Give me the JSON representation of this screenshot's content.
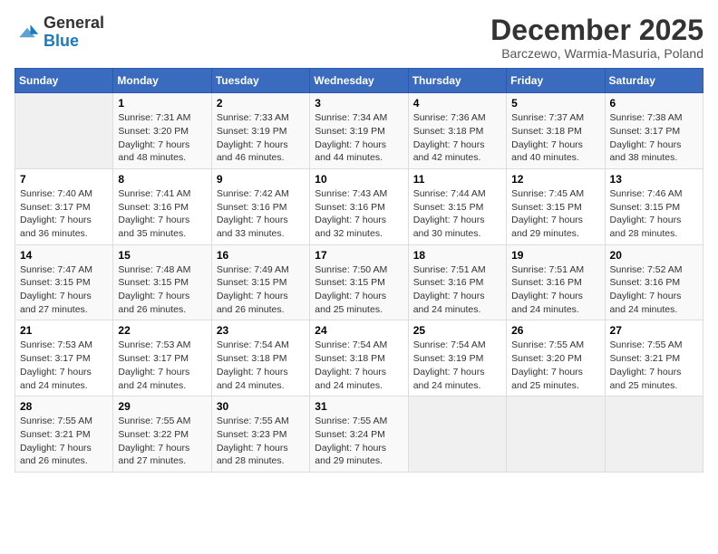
{
  "header": {
    "logo_general": "General",
    "logo_blue": "Blue",
    "title": "December 2025",
    "subtitle": "Barczewo, Warmia-Masuria, Poland"
  },
  "columns": [
    "Sunday",
    "Monday",
    "Tuesday",
    "Wednesday",
    "Thursday",
    "Friday",
    "Saturday"
  ],
  "weeks": [
    [
      {
        "num": "",
        "detail": ""
      },
      {
        "num": "1",
        "detail": "Sunrise: 7:31 AM\nSunset: 3:20 PM\nDaylight: 7 hours\nand 48 minutes."
      },
      {
        "num": "2",
        "detail": "Sunrise: 7:33 AM\nSunset: 3:19 PM\nDaylight: 7 hours\nand 46 minutes."
      },
      {
        "num": "3",
        "detail": "Sunrise: 7:34 AM\nSunset: 3:19 PM\nDaylight: 7 hours\nand 44 minutes."
      },
      {
        "num": "4",
        "detail": "Sunrise: 7:36 AM\nSunset: 3:18 PM\nDaylight: 7 hours\nand 42 minutes."
      },
      {
        "num": "5",
        "detail": "Sunrise: 7:37 AM\nSunset: 3:18 PM\nDaylight: 7 hours\nand 40 minutes."
      },
      {
        "num": "6",
        "detail": "Sunrise: 7:38 AM\nSunset: 3:17 PM\nDaylight: 7 hours\nand 38 minutes."
      }
    ],
    [
      {
        "num": "7",
        "detail": "Sunrise: 7:40 AM\nSunset: 3:17 PM\nDaylight: 7 hours\nand 36 minutes."
      },
      {
        "num": "8",
        "detail": "Sunrise: 7:41 AM\nSunset: 3:16 PM\nDaylight: 7 hours\nand 35 minutes."
      },
      {
        "num": "9",
        "detail": "Sunrise: 7:42 AM\nSunset: 3:16 PM\nDaylight: 7 hours\nand 33 minutes."
      },
      {
        "num": "10",
        "detail": "Sunrise: 7:43 AM\nSunset: 3:16 PM\nDaylight: 7 hours\nand 32 minutes."
      },
      {
        "num": "11",
        "detail": "Sunrise: 7:44 AM\nSunset: 3:15 PM\nDaylight: 7 hours\nand 30 minutes."
      },
      {
        "num": "12",
        "detail": "Sunrise: 7:45 AM\nSunset: 3:15 PM\nDaylight: 7 hours\nand 29 minutes."
      },
      {
        "num": "13",
        "detail": "Sunrise: 7:46 AM\nSunset: 3:15 PM\nDaylight: 7 hours\nand 28 minutes."
      }
    ],
    [
      {
        "num": "14",
        "detail": "Sunrise: 7:47 AM\nSunset: 3:15 PM\nDaylight: 7 hours\nand 27 minutes."
      },
      {
        "num": "15",
        "detail": "Sunrise: 7:48 AM\nSunset: 3:15 PM\nDaylight: 7 hours\nand 26 minutes."
      },
      {
        "num": "16",
        "detail": "Sunrise: 7:49 AM\nSunset: 3:15 PM\nDaylight: 7 hours\nand 26 minutes."
      },
      {
        "num": "17",
        "detail": "Sunrise: 7:50 AM\nSunset: 3:15 PM\nDaylight: 7 hours\nand 25 minutes."
      },
      {
        "num": "18",
        "detail": "Sunrise: 7:51 AM\nSunset: 3:16 PM\nDaylight: 7 hours\nand 24 minutes."
      },
      {
        "num": "19",
        "detail": "Sunrise: 7:51 AM\nSunset: 3:16 PM\nDaylight: 7 hours\nand 24 minutes."
      },
      {
        "num": "20",
        "detail": "Sunrise: 7:52 AM\nSunset: 3:16 PM\nDaylight: 7 hours\nand 24 minutes."
      }
    ],
    [
      {
        "num": "21",
        "detail": "Sunrise: 7:53 AM\nSunset: 3:17 PM\nDaylight: 7 hours\nand 24 minutes."
      },
      {
        "num": "22",
        "detail": "Sunrise: 7:53 AM\nSunset: 3:17 PM\nDaylight: 7 hours\nand 24 minutes."
      },
      {
        "num": "23",
        "detail": "Sunrise: 7:54 AM\nSunset: 3:18 PM\nDaylight: 7 hours\nand 24 minutes."
      },
      {
        "num": "24",
        "detail": "Sunrise: 7:54 AM\nSunset: 3:18 PM\nDaylight: 7 hours\nand 24 minutes."
      },
      {
        "num": "25",
        "detail": "Sunrise: 7:54 AM\nSunset: 3:19 PM\nDaylight: 7 hours\nand 24 minutes."
      },
      {
        "num": "26",
        "detail": "Sunrise: 7:55 AM\nSunset: 3:20 PM\nDaylight: 7 hours\nand 25 minutes."
      },
      {
        "num": "27",
        "detail": "Sunrise: 7:55 AM\nSunset: 3:21 PM\nDaylight: 7 hours\nand 25 minutes."
      }
    ],
    [
      {
        "num": "28",
        "detail": "Sunrise: 7:55 AM\nSunset: 3:21 PM\nDaylight: 7 hours\nand 26 minutes."
      },
      {
        "num": "29",
        "detail": "Sunrise: 7:55 AM\nSunset: 3:22 PM\nDaylight: 7 hours\nand 27 minutes."
      },
      {
        "num": "30",
        "detail": "Sunrise: 7:55 AM\nSunset: 3:23 PM\nDaylight: 7 hours\nand 28 minutes."
      },
      {
        "num": "31",
        "detail": "Sunrise: 7:55 AM\nSunset: 3:24 PM\nDaylight: 7 hours\nand 29 minutes."
      },
      {
        "num": "",
        "detail": ""
      },
      {
        "num": "",
        "detail": ""
      },
      {
        "num": "",
        "detail": ""
      }
    ]
  ]
}
